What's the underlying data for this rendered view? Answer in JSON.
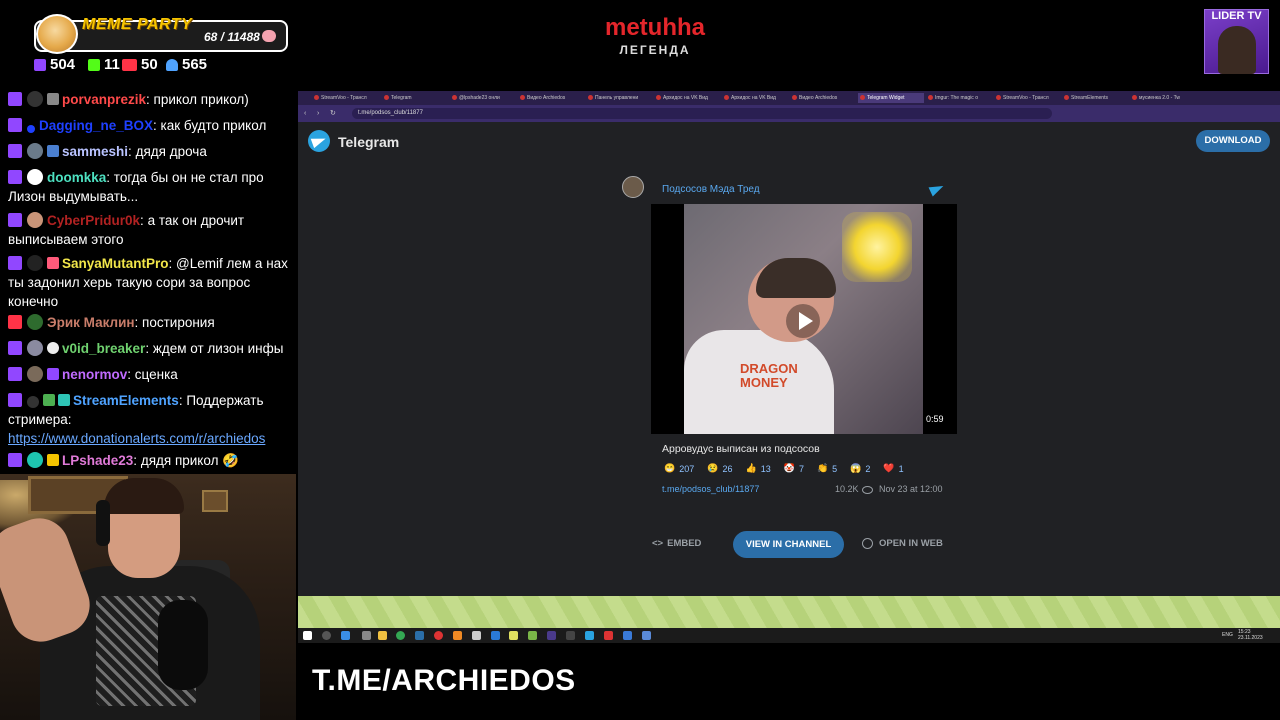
{
  "overlay": {
    "meme_party_title": "MEME PARTY",
    "meme_party_count": "68 / 11488",
    "stats": [
      {
        "icon": "twitch-icon",
        "value": "504",
        "color": "#9147ff"
      },
      {
        "icon": "kick-icon",
        "value": "11",
        "color": "#53fc18"
      },
      {
        "icon": "vk-live-icon",
        "value": "50",
        "color": "#ff3347"
      },
      {
        "icon": "user-icon",
        "value": "565",
        "color": "#4fa3ff"
      }
    ],
    "stream_title": "metuhha",
    "stream_subtitle": "ЛЕГЕНДА",
    "lider_tv": "LIDER TV",
    "bottom_text": "T.ME/ARCHIEDOS"
  },
  "chat": [
    {
      "platform": "twitch",
      "name": "porvanprezik",
      "name_color": "#ff4a4a",
      "text": " прикол прикол)"
    },
    {
      "platform": "twitch",
      "name": "Dagging_ne_BOX",
      "name_color": "#1e40ff",
      "text": " как будто прикол"
    },
    {
      "platform": "twitch",
      "name": "sammeshi",
      "name_color": "#b9c3ff",
      "text": " дядя дроча"
    },
    {
      "platform": "twitch",
      "name": "doomkka",
      "name_color": "#4de1c1",
      "text": " тогда бы он не стал про Лизон выдумывать..."
    },
    {
      "platform": "twitch",
      "name": "CyberPridur0k",
      "name_color": "#b22222",
      "text": " а так он дрочит выписываем этого"
    },
    {
      "platform": "twitch",
      "name": "SanyaMutantPro",
      "name_color": "#f2e64a",
      "text": " @Lemif лем а нах ты задонил херь такую сори за вопрос конечно"
    },
    {
      "platform": "vk",
      "name": "Эрик Маклин",
      "name_color": "#c97d6a",
      "text": " постирония"
    },
    {
      "platform": "twitch",
      "name": "v0id_breaker",
      "name_color": "#6fd16f",
      "text": " ждем от лизон инфы"
    },
    {
      "platform": "twitch",
      "name": "nenormov",
      "name_color": "#c06bff",
      "text": " сценка"
    },
    {
      "platform": "twitch",
      "name": "StreamElements",
      "name_color": "#4fa3ff",
      "text": " Поддержать стримера:",
      "link": "https://www.donationalerts.com/r/archiedos"
    },
    {
      "platform": "twitch",
      "name": "LPshade23",
      "name_color": "#e07ad8",
      "text": " дядя прикол 🤣"
    }
  ],
  "browser": {
    "tabs": [
      "StreamVoo - Трансл",
      "Telegram",
      "@lpshade23 онли",
      "Видео Archiedos",
      "Панель управлени",
      "Архидос на VK Вид",
      "Архидос на VK Вид",
      "Видео Archiedos",
      "Telegram Widget",
      "Imgur: The magic o",
      "StreamVoo - Трансл",
      "StreamElements",
      "мусиенка 2.0 - Tw"
    ],
    "active_tab": 8,
    "url": "t.me/podsos_club/11877"
  },
  "telegram": {
    "brand": "Telegram",
    "download_label": "DOWNLOAD",
    "channel_name": "Подсосов Мэда Тред",
    "video_duration": "0:59",
    "video_caption_text": "DRAGON MONEY",
    "post_text": "Арровудус выписан из подсосов",
    "reactions": [
      {
        "emoji": "😁",
        "count": "207"
      },
      {
        "emoji": "😢",
        "count": "26"
      },
      {
        "emoji": "👍",
        "count": "13"
      },
      {
        "emoji": "🤡",
        "count": "7"
      },
      {
        "emoji": "👏",
        "count": "5"
      },
      {
        "emoji": "😱",
        "count": "2"
      },
      {
        "emoji": "❤️",
        "count": "1"
      }
    ],
    "post_link": "t.me/podsos_club/11877",
    "views": "10.2K",
    "date": "Nov 23 at 12:00",
    "embed_label": "EMBED",
    "view_in_channel_label": "VIEW IN CHANNEL",
    "open_in_web_label": "OPEN IN WEB"
  },
  "taskbar": {
    "lang": "ENG",
    "time": "15:23",
    "date": "23.11.2023"
  }
}
